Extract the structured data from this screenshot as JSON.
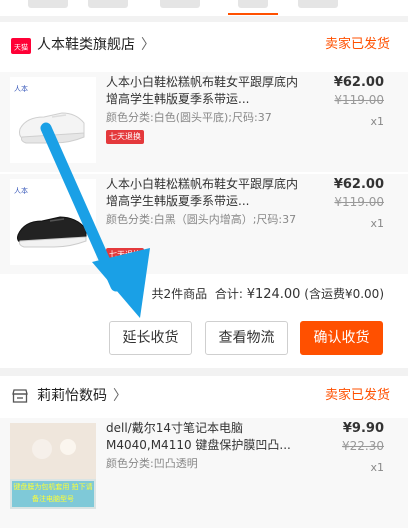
{
  "store1": {
    "name": "人本鞋类旗舰店",
    "chevron": "〉",
    "status": "卖家已发货",
    "badge": "天猫",
    "items": [
      {
        "brand": "人本",
        "title": "人本小白鞋松糕帆布鞋女平跟厚底内增高学生韩版夏季系带运...",
        "sku": "颜色分类:白色(圆头平底);尺码:37",
        "price": "¥62.00",
        "original_price": "¥119.00",
        "qty": "x1",
        "tag": "七天退换"
      },
      {
        "brand": "人本",
        "title": "人本小白鞋松糕帆布鞋女平跟厚底内增高学生韩版夏季系带运...",
        "sku": "颜色分类:白黑（圆头内增高）;尺码:37",
        "price": "¥62.00",
        "original_price": "¥119.00",
        "qty": "x1",
        "tag": "七天退换"
      }
    ],
    "summary_count": "共2件商品",
    "summary_total_label": "合计:",
    "summary_amount": "¥124.00",
    "summary_shipping": "(含运费¥0.00)",
    "buttons": {
      "extend": "延长收货",
      "logistics": "查看物流",
      "confirm": "确认收货"
    }
  },
  "store2": {
    "name": "莉莉怡数码",
    "chevron": "〉",
    "status": "卖家已发货",
    "items": [
      {
        "title": "dell/戴尔14寸笔记本电脑M4040,M4110 键盘保护膜凹凸...",
        "sku": "颜色分类:凹凸透明",
        "price": "¥9.90",
        "original_price": "¥22.30",
        "qty": "x1",
        "thumb_caption": "键盘膜为包机套用 拍下请备注电脑型号"
      }
    ]
  },
  "colors": {
    "accent": "#ff5000",
    "arrow": "#1aa0e6"
  }
}
